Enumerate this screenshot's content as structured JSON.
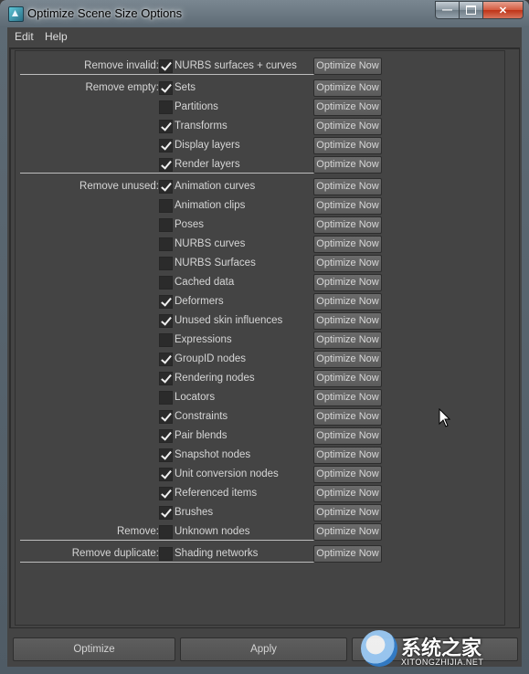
{
  "window": {
    "title": "Optimize Scene Size Options"
  },
  "menu": {
    "items": [
      "Edit",
      "Help"
    ]
  },
  "button_label": "Optimize Now",
  "rows": [
    {
      "group_label": "Remove invalid:",
      "item": "NURBS surfaces + curves",
      "checked": true
    },
    {
      "group_label": "Remove empty:",
      "item": "Sets",
      "checked": true
    },
    {
      "group_label": "",
      "item": "Partitions",
      "checked": false
    },
    {
      "group_label": "",
      "item": "Transforms",
      "checked": true
    },
    {
      "group_label": "",
      "item": "Display layers",
      "checked": true
    },
    {
      "group_label": "",
      "item": "Render layers",
      "checked": true
    },
    {
      "group_label": "Remove unused:",
      "item": "Animation curves",
      "checked": true
    },
    {
      "group_label": "",
      "item": "Animation clips",
      "checked": false
    },
    {
      "group_label": "",
      "item": "Poses",
      "checked": false
    },
    {
      "group_label": "",
      "item": "NURBS curves",
      "checked": false
    },
    {
      "group_label": "",
      "item": "NURBS Surfaces",
      "checked": false
    },
    {
      "group_label": "",
      "item": "Cached data",
      "checked": false
    },
    {
      "group_label": "",
      "item": "Deformers",
      "checked": true
    },
    {
      "group_label": "",
      "item": "Unused skin influences",
      "checked": true
    },
    {
      "group_label": "",
      "item": "Expressions",
      "checked": false
    },
    {
      "group_label": "",
      "item": "GroupID nodes",
      "checked": true
    },
    {
      "group_label": "",
      "item": "Rendering nodes",
      "checked": true
    },
    {
      "group_label": "",
      "item": "Locators",
      "checked": false
    },
    {
      "group_label": "",
      "item": "Constraints",
      "checked": true
    },
    {
      "group_label": "",
      "item": "Pair blends",
      "checked": true
    },
    {
      "group_label": "",
      "item": "Snapshot nodes",
      "checked": true
    },
    {
      "group_label": "",
      "item": "Unit conversion nodes",
      "checked": true
    },
    {
      "group_label": "",
      "item": "Referenced items",
      "checked": true
    },
    {
      "group_label": "",
      "item": "Brushes",
      "checked": true
    },
    {
      "group_label": "Remove:",
      "item": "Unknown nodes",
      "checked": false
    },
    {
      "group_label": "Remove duplicate:",
      "item": "Shading networks",
      "checked": false
    }
  ],
  "footer": {
    "optimize": "Optimize",
    "apply": "Apply"
  },
  "watermark": {
    "text": "系统之家",
    "sub": "XITONGZHIJIA.NET"
  }
}
